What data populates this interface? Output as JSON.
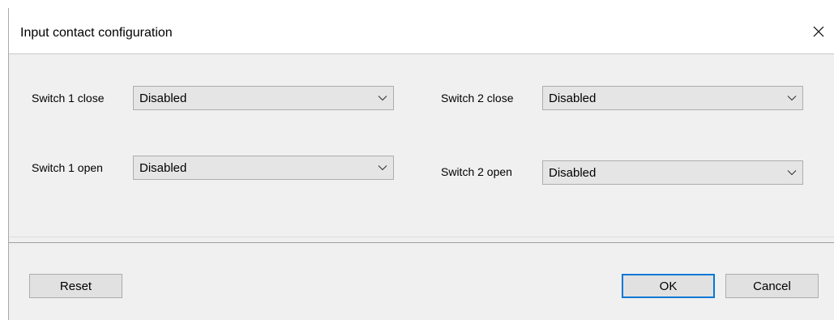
{
  "window": {
    "title": "Input contact configuration",
    "close_icon": "close-icon"
  },
  "fields": {
    "switch1_close": {
      "label": "Switch 1 close",
      "value": "Disabled"
    },
    "switch1_open": {
      "label": "Switch 1 open",
      "value": "Disabled"
    },
    "switch2_close": {
      "label": "Switch 2 close",
      "value": "Disabled"
    },
    "switch2_open": {
      "label": "Switch 2 open",
      "value": "Disabled"
    }
  },
  "buttons": {
    "reset": "Reset",
    "ok": "OK",
    "cancel": "Cancel"
  },
  "colors": {
    "default_button_border": "#0078d7",
    "dialog_background": "#f0f0f0"
  }
}
